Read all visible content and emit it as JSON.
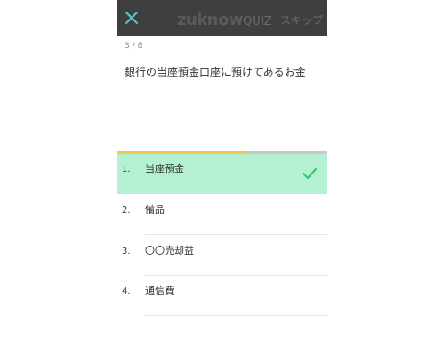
{
  "header": {
    "close_icon": "close-x-icon",
    "logo_brand": "zuknow",
    "logo_sub": "QUIZ",
    "skip_label": "スキップ",
    "background": "#3f3f3f",
    "accent": "#49c9c7"
  },
  "progress": {
    "label": "3 / 8",
    "current": 3,
    "total": 8,
    "fill_fraction": 0.625,
    "fill_color": "#f2c94c"
  },
  "question": {
    "text": "銀行の当座預金口座に預けてあるお金"
  },
  "answers": [
    {
      "num": "1.",
      "text": "当座預金",
      "selected": true,
      "icon": "checkmark-icon"
    },
    {
      "num": "2.",
      "text": "備品",
      "selected": false
    },
    {
      "num": "3.",
      "text": "〇〇売却益",
      "selected": false
    },
    {
      "num": "4.",
      "text": "通信費",
      "selected": false
    }
  ],
  "colors": {
    "selected_background": "#b4f1d2",
    "check_color": "#2ecc71"
  }
}
